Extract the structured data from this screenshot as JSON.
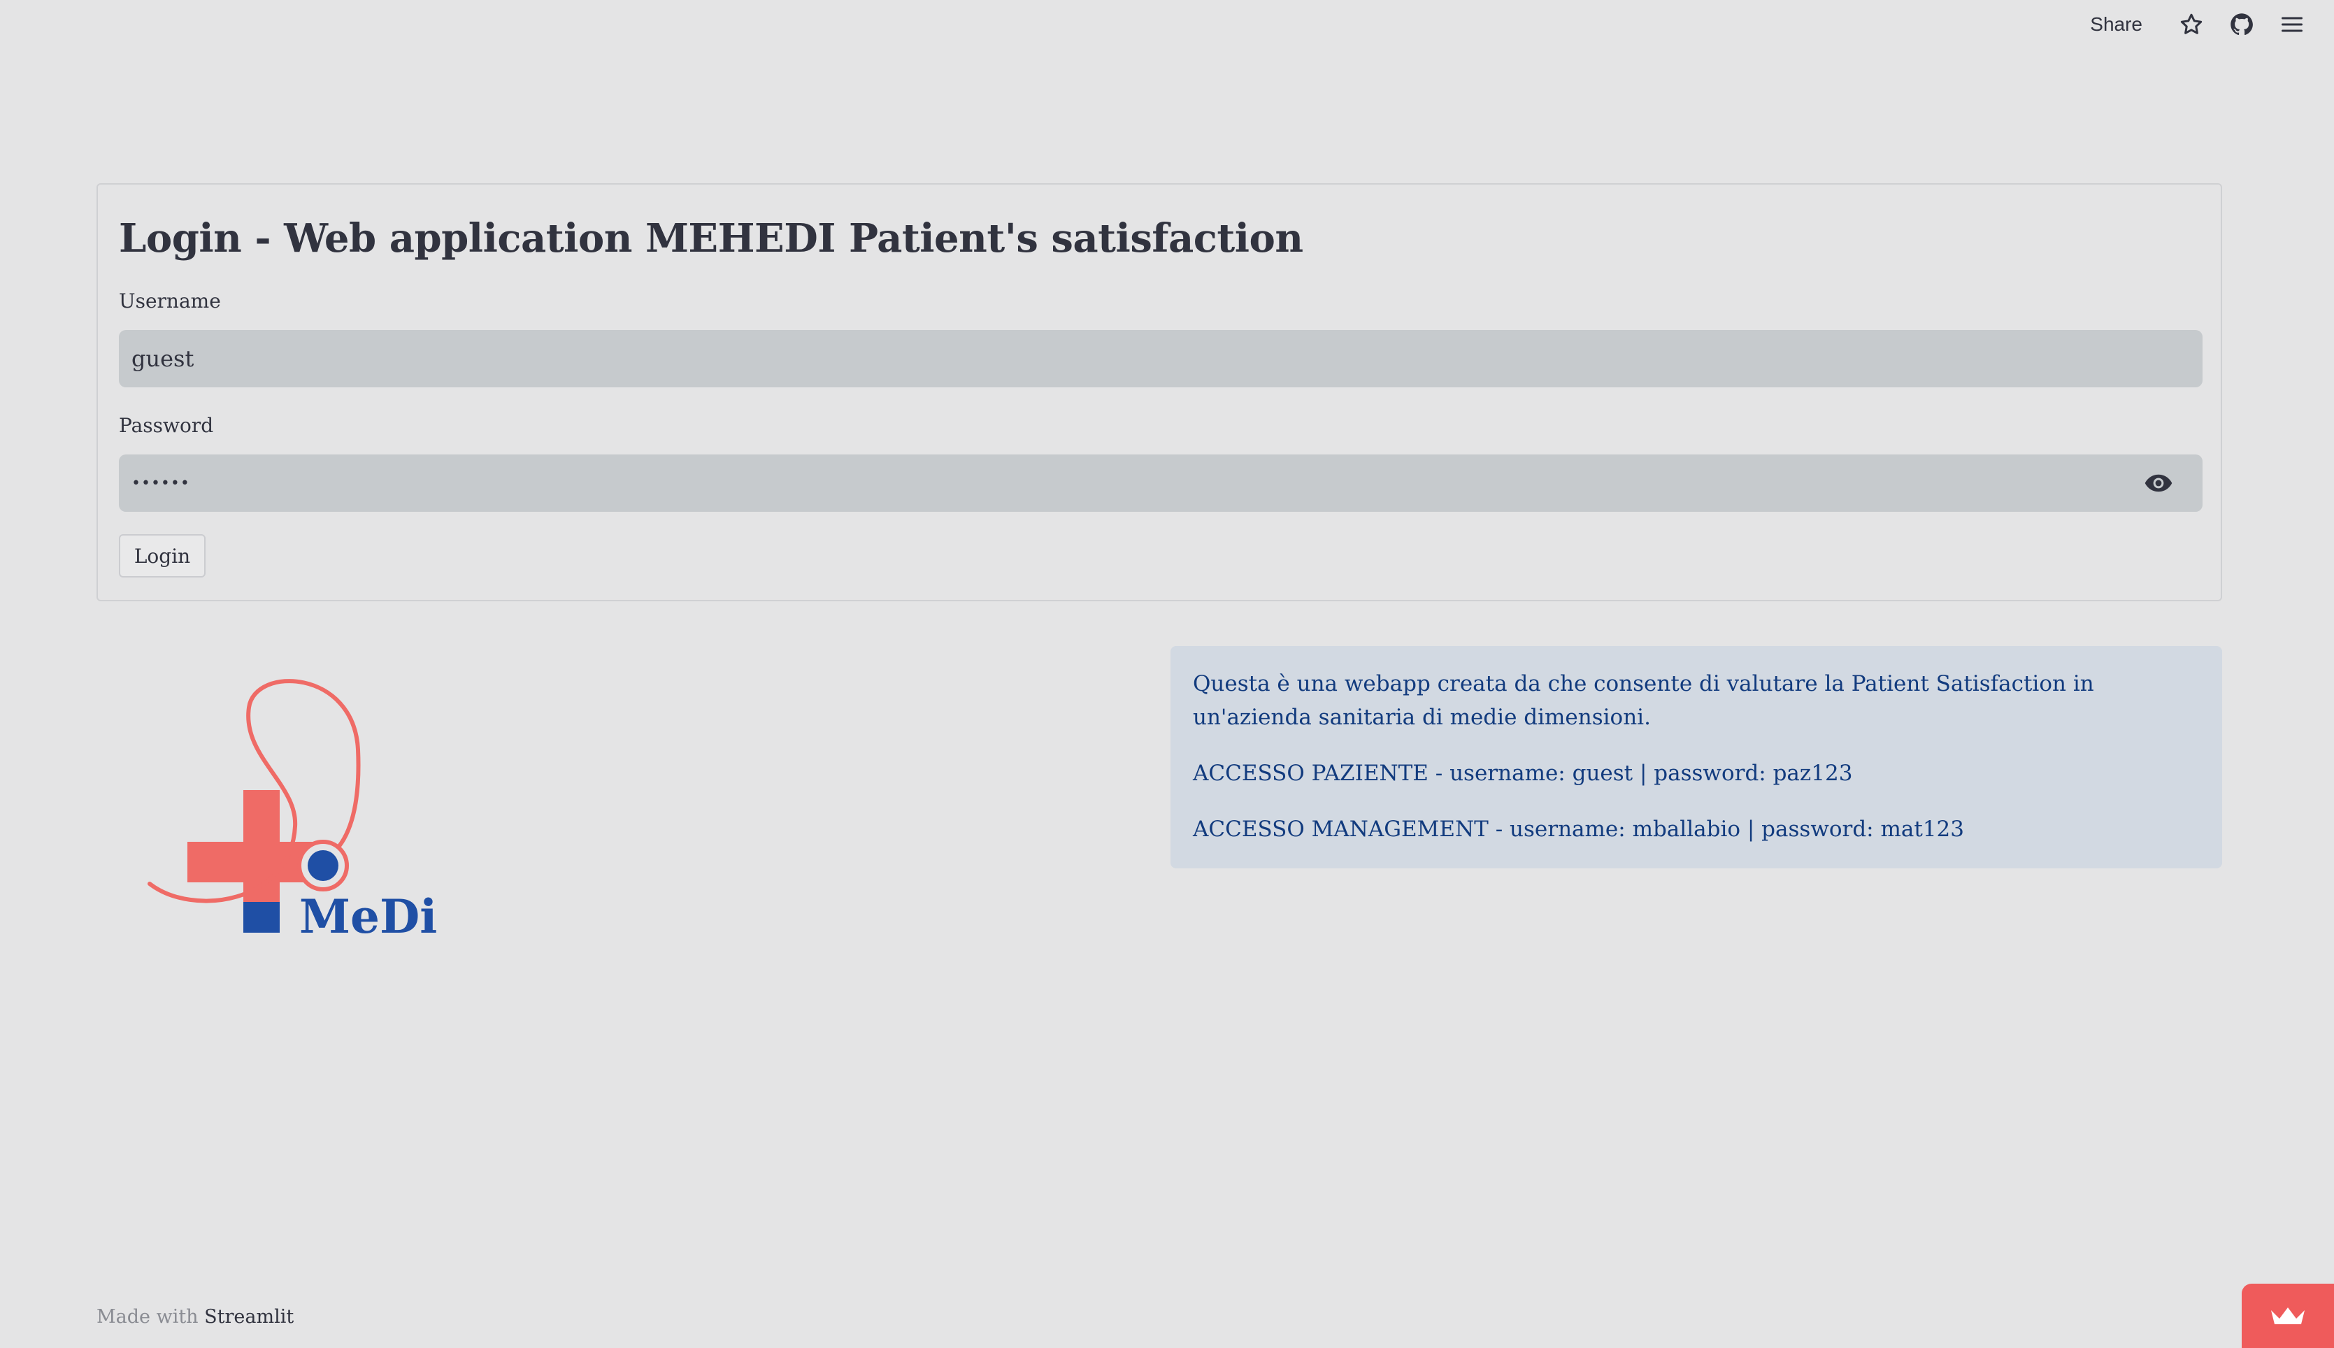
{
  "toolbar": {
    "share_label": "Share",
    "icons": [
      "star-icon",
      "github-icon",
      "menu-icon"
    ]
  },
  "login_form": {
    "title": "Login - Web application MEHEDI Patient's satisfaction",
    "username_label": "Username",
    "username_value": "guest",
    "password_label": "Password",
    "password_masked": "••••••",
    "login_button": "Login"
  },
  "logo": {
    "text": "MeDi",
    "colors": {
      "red": "#ef6b66",
      "blue": "#1f4fa5"
    }
  },
  "info": {
    "description": "Questa è una webapp creata da che consente di valutare la Patient Satisfaction in un'azienda sanitaria di medie dimensioni.",
    "access_patient": "ACCESSO PAZIENTE - username: guest | password: paz123",
    "access_management": "ACCESSO MANAGEMENT - username: mballabio | password: mat123"
  },
  "footer": {
    "made_with": "Made with",
    "brand": "Streamlit"
  },
  "colors": {
    "background": "#e4e4e5",
    "input_bg": "#c6cacd",
    "info_bg": "#d2d9e2",
    "info_text": "#123b7e",
    "badge": "#ef5b5b"
  }
}
